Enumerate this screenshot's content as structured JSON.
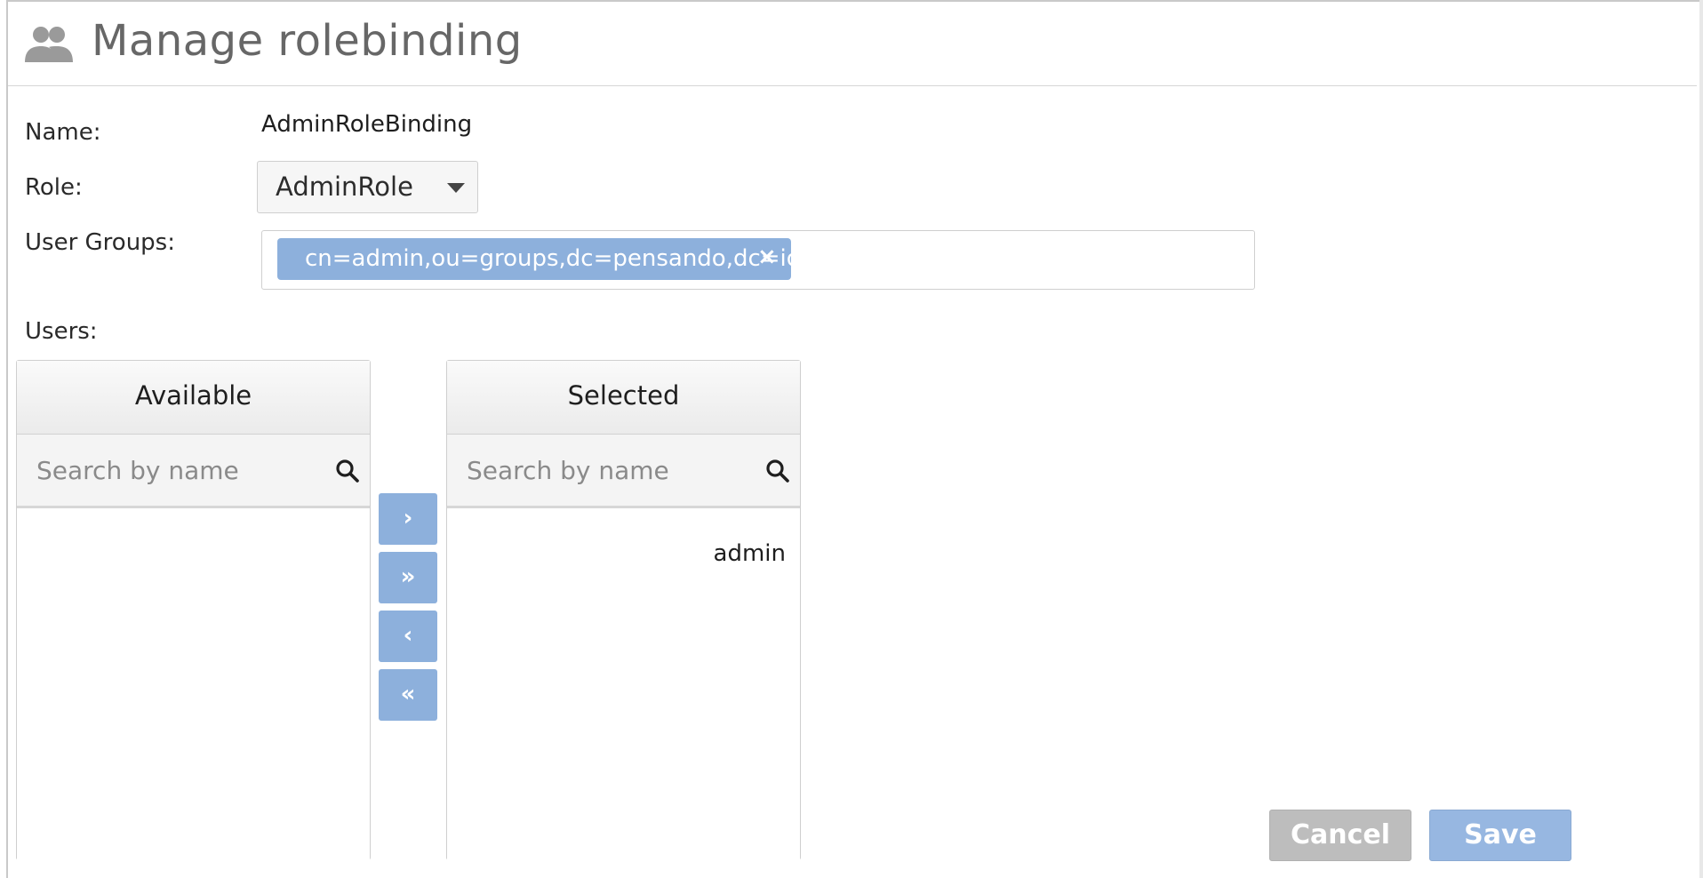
{
  "header": {
    "title": "Manage rolebinding",
    "icon": "people-icon"
  },
  "form": {
    "name_label": "Name:",
    "name_value": "AdminRoleBinding",
    "role_label": "Role:",
    "role_value": "AdminRole",
    "user_groups_label": "User Groups:",
    "user_groups": [
      {
        "label": "cn=admin,ou=groups,dc=pensando,dc=io",
        "remove": "×"
      }
    ],
    "users_label": "Users:"
  },
  "picklist": {
    "available": {
      "title": "Available",
      "search_placeholder": "Search by name",
      "items": []
    },
    "selected": {
      "title": "Selected",
      "search_placeholder": "Search by name",
      "items": [
        "admin"
      ]
    },
    "controls": {
      "move_right": "›",
      "move_all_right": "»",
      "move_left": "‹",
      "move_all_left": "«"
    }
  },
  "actions": {
    "cancel_label": "Cancel",
    "save_label": "Save"
  },
  "colors": {
    "accent": "#8db0dc",
    "title_gray": "#676767",
    "cancel_gray": "#bdbdbd"
  }
}
